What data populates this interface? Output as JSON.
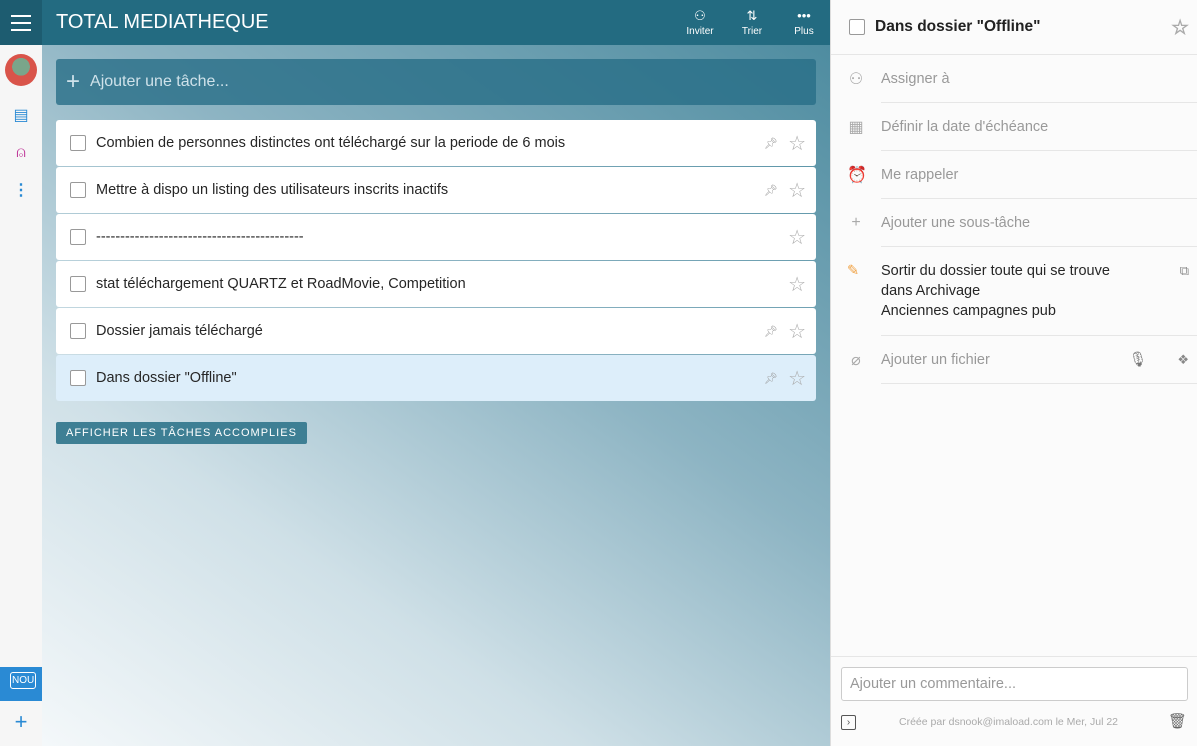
{
  "header": {
    "title": "TOTAL MEDIATHEQUE",
    "invite": "Inviter",
    "sort": "Trier",
    "more": "Plus"
  },
  "sidebar": {
    "new_label": "NOU"
  },
  "add_task": {
    "placeholder": "Ajouter une tâche..."
  },
  "tasks": [
    {
      "title": "Combien de personnes distinctes ont téléchargé sur la periode de 6 mois",
      "pinned": true
    },
    {
      "title": "Mettre à dispo un listing des utilisateurs inscrits inactifs",
      "pinned": true
    },
    {
      "title": "-------------------------------------------",
      "pinned": false
    },
    {
      "title": "stat téléchargement QUARTZ et RoadMovie, Competition",
      "pinned": false
    },
    {
      "title": "Dossier jamais téléchargé",
      "pinned": true
    },
    {
      "title": "Dans dossier \"Offline\"",
      "pinned": true,
      "selected": true
    }
  ],
  "show_completed": "AFFICHER LES TÂCHES ACCOMPLIES",
  "detail": {
    "title": "Dans dossier \"Offline\"",
    "assign": "Assigner à",
    "due": "Définir la date d'échéance",
    "remind": "Me rappeler",
    "subtask": "Ajouter une sous-tâche",
    "note_lines": [
      "Sortir du dossier toute qui se trouve",
      "dans Archivage",
      "Anciennes campagnes pub"
    ],
    "file": "Ajouter un fichier",
    "comment_placeholder": "Ajouter un commentaire...",
    "created": "Créée par  dsnook@imaload.com  le  Mer, Jul 22"
  }
}
